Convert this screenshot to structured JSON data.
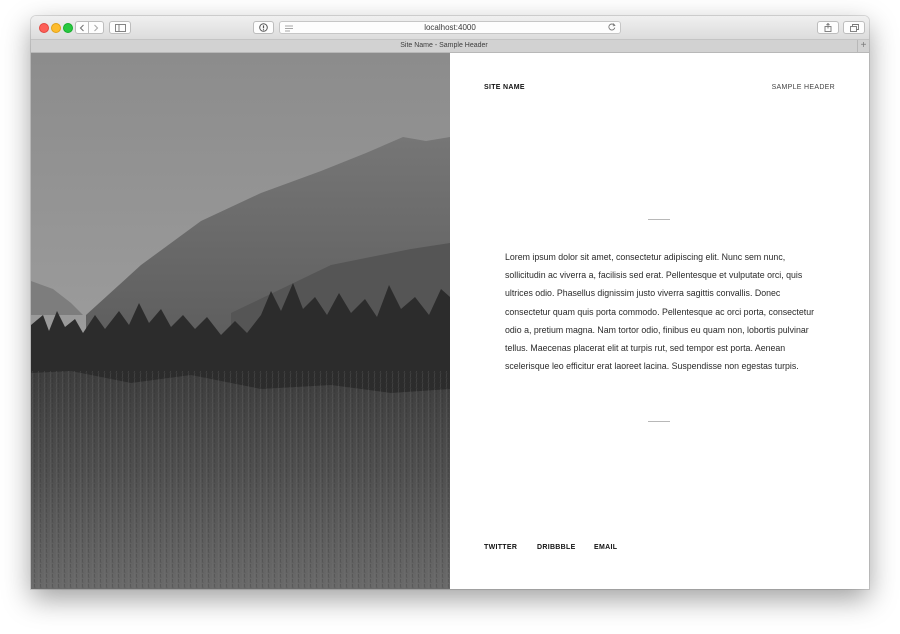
{
  "browser": {
    "address": "localhost:4000",
    "tab_title": "Site Name - Sample Header",
    "new_tab": "+"
  },
  "header": {
    "site_name": "SITE NAME",
    "sample_header": "SAMPLE HEADER"
  },
  "main": {
    "body": "Lorem ipsum dolor sit amet, consectetur adipiscing elit. Nunc sem nunc, sollicitudin ac viverra a, facilisis sed erat. Pellentesque et vulputate orci, quis ultrices odio. Phasellus dignissim justo viverra sagittis convallis. Donec consectetur quam quis porta commodo. Pellentesque ac orci porta, consectetur odio a, pretium magna. Nam tortor odio, finibus eu quam non, lobortis pulvinar tellus. Maecenas placerat elit at turpis rut, sed tempor est porta. Aenean scelerisque leo efficitur erat laoreet lacina. Suspendisse non egestas turpis."
  },
  "footer": {
    "links": [
      "TWITTER",
      "DRIBBBLE",
      "EMAIL"
    ]
  },
  "icons": {
    "back": "chevron-left-icon",
    "forward": "chevron-right-icon",
    "sidebar": "sidebar-icon",
    "info": "info-icon",
    "reader": "reader-icon",
    "reload": "reload-icon",
    "share": "share-icon",
    "tabs": "tabs-icon"
  },
  "colors": {
    "close": "#fd5f57",
    "minimize": "#febc2e",
    "zoom": "#28c840"
  }
}
